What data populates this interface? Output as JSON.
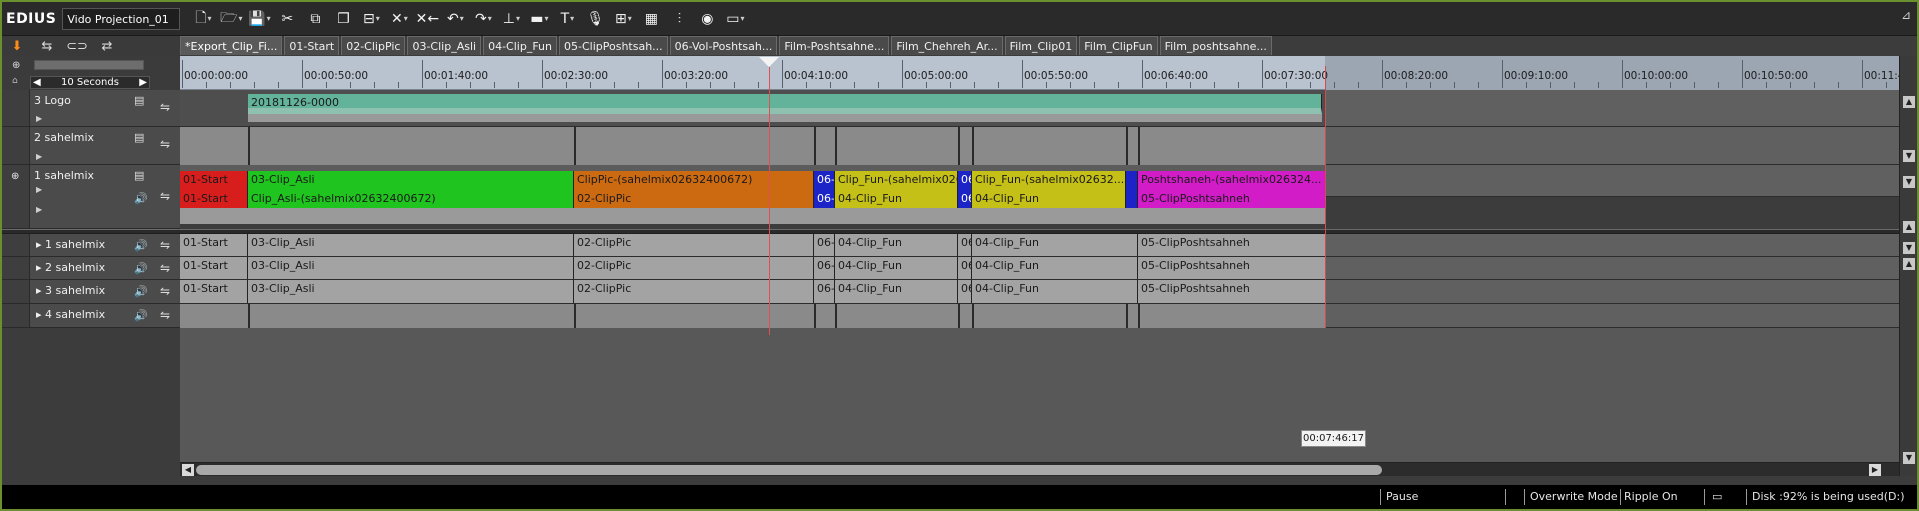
{
  "app": {
    "name": "EDIUS",
    "project": "Vido Projection_01"
  },
  "toolbar": {
    "icons": [
      "new-document-icon",
      "open-folder-icon",
      "save-icon",
      "cut-icon",
      "copy-icon",
      "paste-icon",
      "insert-icon",
      "delete-icon",
      "ripple-delete-icon",
      "undo-icon",
      "redo-icon",
      "audio-level-icon",
      "trim-icon",
      "text-icon",
      "mic-icon",
      "layout-icon",
      "table-icon",
      "mixer-icon",
      "color-icon",
      "monitor-icon"
    ]
  },
  "tabs": [
    {
      "label": "*Export_Clip_Fi...",
      "active": true
    },
    {
      "label": "01-Start",
      "active": false
    },
    {
      "label": "02-ClipPic",
      "active": false
    },
    {
      "label": "03-Clip_Asli",
      "active": false
    },
    {
      "label": "04-Clip_Fun",
      "active": false
    },
    {
      "label": "05-ClipPoshtsah...",
      "active": false
    },
    {
      "label": "06-Vol-Poshtsah...",
      "active": false
    },
    {
      "label": "Film-Poshtsahne...",
      "active": false
    },
    {
      "label": "Film_Chehreh_Ar...",
      "active": false
    },
    {
      "label": "Film_Clip01",
      "active": false
    },
    {
      "label": "Film_ClipFun",
      "active": false
    },
    {
      "label": "Film_poshtsahne...",
      "active": false
    }
  ],
  "timescale": {
    "label": "10 Seconds"
  },
  "ruler": {
    "labels": [
      "00:00:00:00",
      "00:00:50:00",
      "00:01:40:00",
      "00:02:30:00",
      "00:03:20:00",
      "00:04:10:00",
      "00:05:00:00",
      "00:05:50:00",
      "00:06:40:00",
      "00:07:30:00",
      "00:08:20:00",
      "00:09:10:00",
      "00:10:00:00",
      "00:10:50:00",
      "00:11:4"
    ]
  },
  "tracks": {
    "t3": {
      "name": "3 Logo",
      "clip": "20181126-0000"
    },
    "t2": {
      "name": "2 sahelmix"
    },
    "t1": {
      "name": "1 sahelmix",
      "video": [
        "01-Start",
        "03-Clip_Asli",
        "ClipPic-(sahelmix02632400672)",
        "06-",
        "Clip_Fun-(sahelmix026",
        "06",
        "Clip_Fun-(sahelmix02632...",
        "",
        "Poshtshaneh-(sahelmix026324..."
      ],
      "audio": [
        "01-Start",
        "Clip_Asli-(sahelmix02632400672)",
        "02-ClipPic",
        "06-",
        "04-Clip_Fun",
        "06",
        "04-Clip_Fun",
        "",
        "05-ClipPoshtsahneh"
      ]
    },
    "audio": [
      {
        "name": "1 sahelmix",
        "clips": [
          "01-Start",
          "03-Clip_Asli",
          "02-ClipPic",
          "06-",
          "04-Clip_Fun",
          "06",
          "04-Clip_Fun",
          "05-ClipPoshtsahneh"
        ]
      },
      {
        "name": "2 sahelmix",
        "clips": [
          "01-Start",
          "03-Clip_Asli",
          "02-ClipPic",
          "06-",
          "04-Clip_Fun",
          "06",
          "04-Clip_Fun",
          "05-ClipPoshtsahneh"
        ]
      },
      {
        "name": "3 sahelmix",
        "clips": [
          "01-Start",
          "03-Clip_Asli",
          "02-ClipPic",
          "06-",
          "04-Clip_Fun",
          "06",
          "04-Clip_Fun",
          "05-ClipPoshtsahneh"
        ]
      },
      {
        "name": "4 sahelmix",
        "clips": []
      }
    ]
  },
  "tooltip": "00:07:46:17",
  "status": {
    "state": "Pause",
    "mode": "Overwrite Mode",
    "ripple": "Ripple On",
    "disk": "Disk :92% is being used(D:)"
  },
  "colors": {
    "frame": "#6a8f2e",
    "red": "#d81d1d",
    "green": "#1fc41f",
    "orange": "#cc6a12",
    "blue": "#1c24c8",
    "yellow": "#c4c018",
    "magenta": "#d21cc8",
    "teal": "#62b39a"
  }
}
